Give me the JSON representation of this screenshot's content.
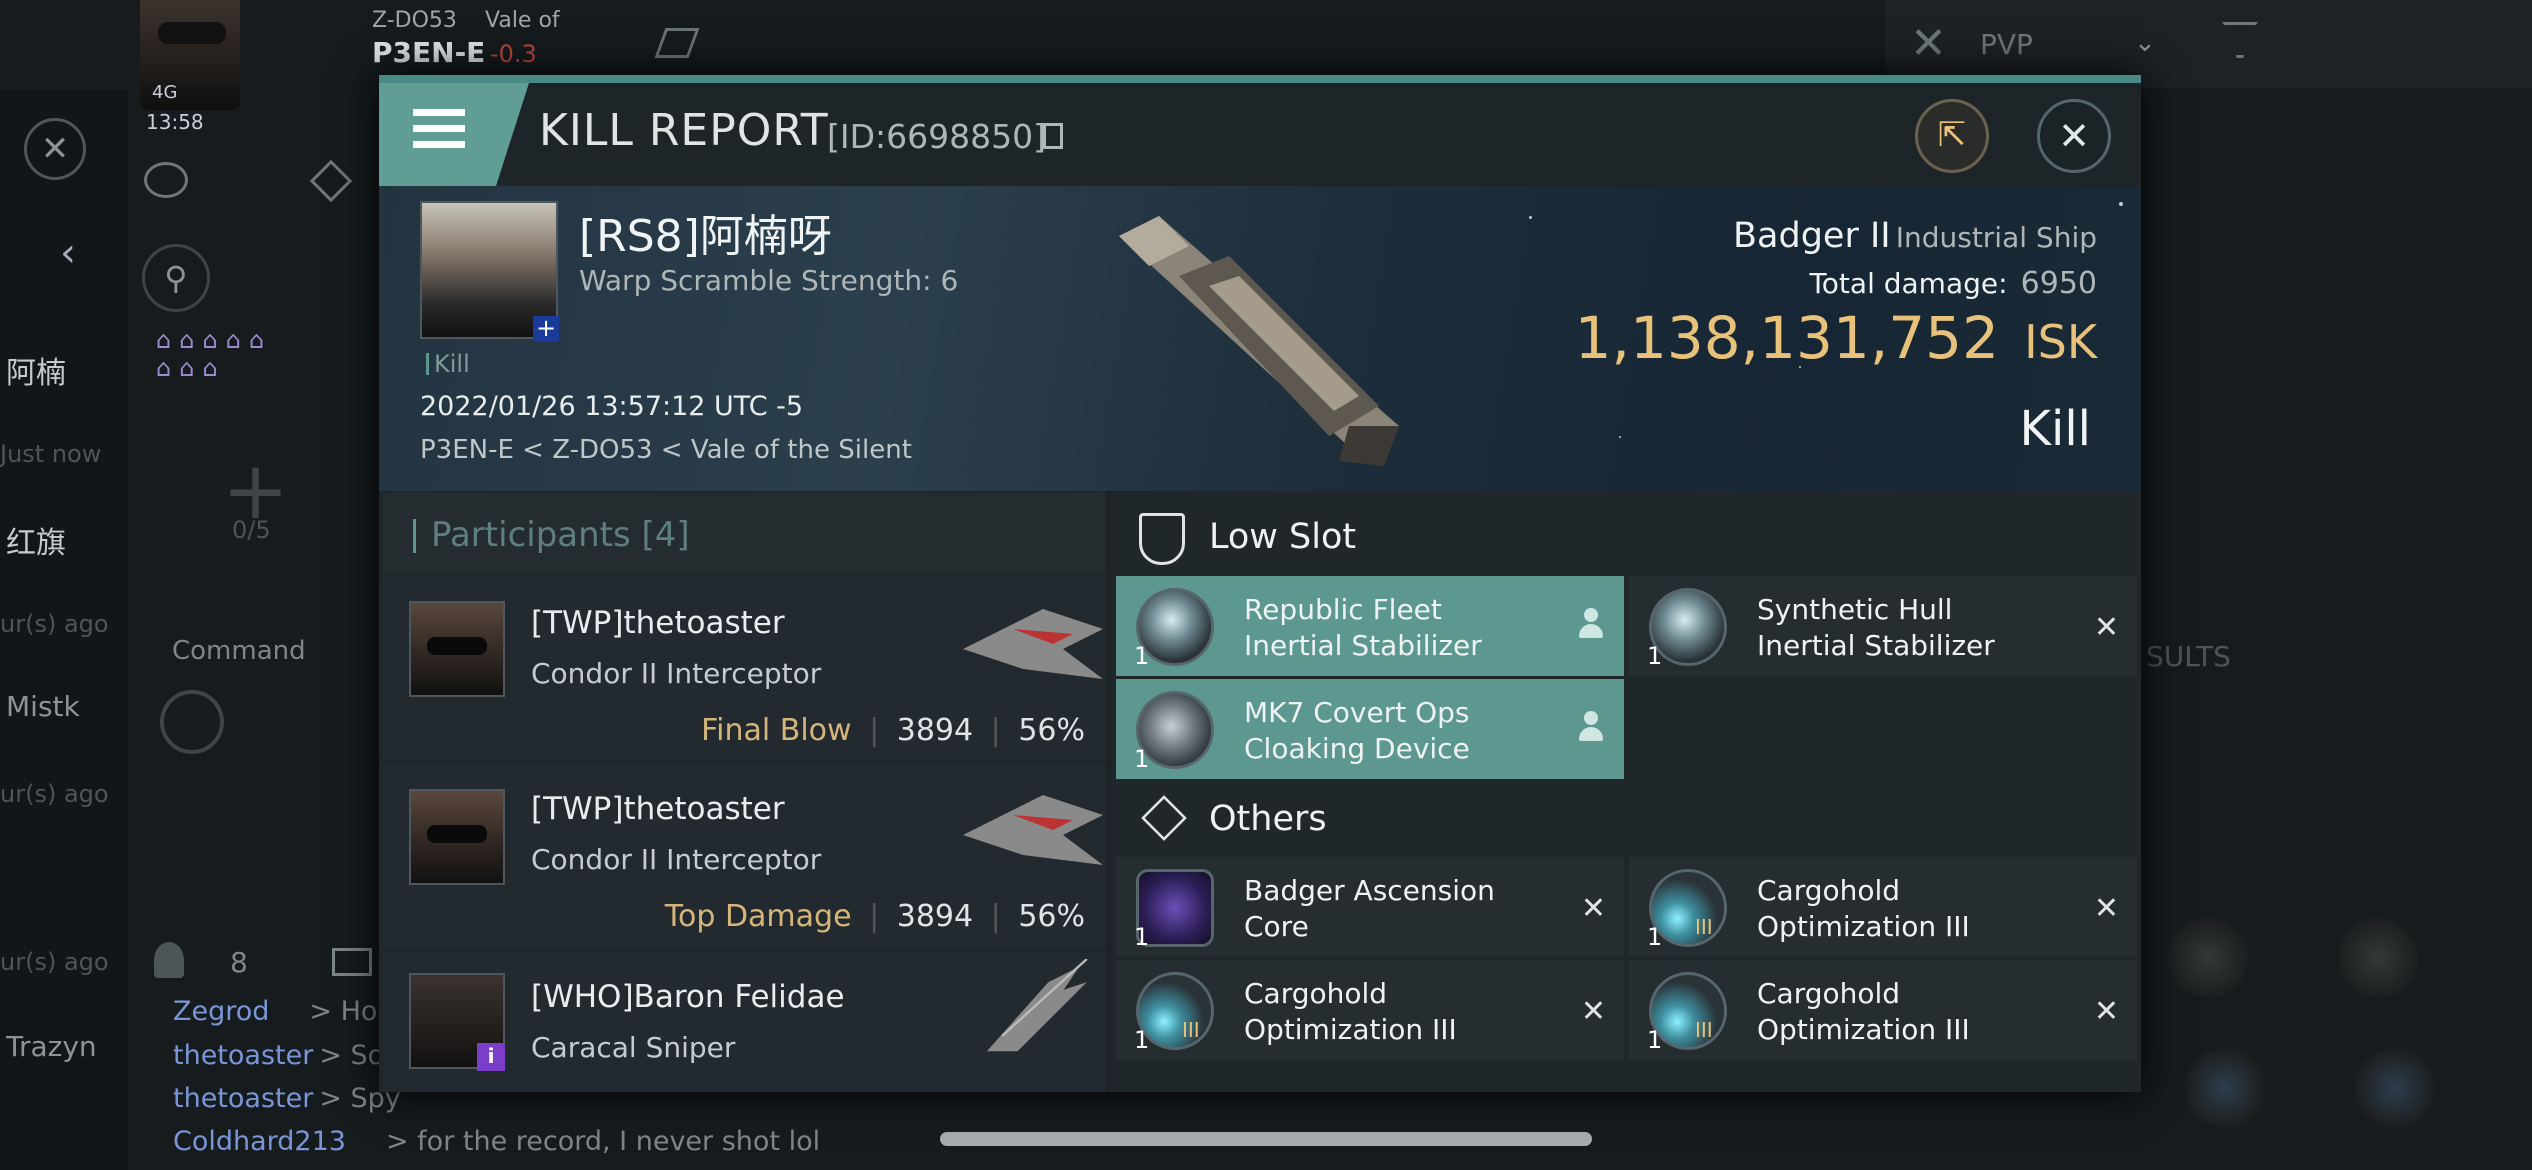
{
  "background": {
    "pilot": {
      "system": "Z-DO53",
      "region_prefix": "Vale of",
      "location": "P3EN-E",
      "security": "-0.3",
      "signal": "4G",
      "time": "13:58"
    },
    "filter": {
      "label": "PVP"
    },
    "left_labels": [
      "阿楠",
      "Just now",
      "红旗",
      "ur(s) ago",
      "Mistk",
      "ur(s) ago",
      "ur(s) ago",
      "Trazyn"
    ],
    "mid_panel": {
      "fleet_count": "0/5",
      "command_label": "Command",
      "members_count": "8"
    },
    "right_label": "SULTS",
    "chat": [
      {
        "name": "Zegrod",
        "text": "> How"
      },
      {
        "name": "thetoaster",
        "text": "> So"
      },
      {
        "name": "thetoaster",
        "text": "> Spy"
      },
      {
        "name": "Coldhard213",
        "text": "> for the record, I never shot lol"
      }
    ]
  },
  "report": {
    "title": "KILL REPORT",
    "id": "[ID:6698850]",
    "victim": {
      "name": "[RS8]阿楠呀",
      "warp_scramble": "Warp Scramble Strength: 6",
      "tag": "Kill",
      "datetime": "2022/01/26 13:57:12 UTC -5",
      "location": "P3EN-E < Z-DO53 < Vale of the Silent"
    },
    "ship": {
      "name": "Badger II",
      "class": "Industrial Ship",
      "total_damage_label": "Total damage:",
      "total_damage": "6950",
      "isk_value": "1,138,131,752",
      "isk_unit": "ISK",
      "result": "Kill"
    },
    "participants": {
      "label": "Participants",
      "count": "[4]",
      "items": [
        {
          "name": "[TWP]thetoaster",
          "ship": "Condor II Interceptor",
          "tag": "Final Blow",
          "damage": "3894",
          "percent": "56%"
        },
        {
          "name": "[TWP]thetoaster",
          "ship": "Condor II Interceptor",
          "tag": "Top Damage",
          "damage": "3894",
          "percent": "56%"
        },
        {
          "name": "[WHO]Baron Felidae",
          "ship": "Caracal Sniper",
          "tag": "",
          "damage": "",
          "percent": ""
        }
      ]
    },
    "low_slot": {
      "label": "Low Slot",
      "items": [
        {
          "name": "Republic Fleet Inertial Stabilizer",
          "qty": "1",
          "state": "fitted"
        },
        {
          "name": "Synthetic Hull Inertial Stabilizer",
          "qty": "1",
          "state": "destroyed"
        },
        {
          "name": "MK7 Covert Ops Cloaking Device",
          "qty": "1",
          "state": "fitted"
        }
      ]
    },
    "others": {
      "label": "Others",
      "items": [
        {
          "name": "Badger Ascension Core",
          "qty": "1",
          "state": "destroyed"
        },
        {
          "name": "Cargohold Optimization III",
          "qty": "1",
          "state": "destroyed"
        },
        {
          "name": "Cargohold Optimization III",
          "qty": "1",
          "state": "destroyed"
        },
        {
          "name": "Cargohold Optimization III",
          "qty": "1",
          "state": "destroyed"
        }
      ]
    }
  },
  "colors": {
    "accent_teal": "#5c988f",
    "isk_gold": "#e8c27a",
    "final_blow": "#d4b57a"
  }
}
